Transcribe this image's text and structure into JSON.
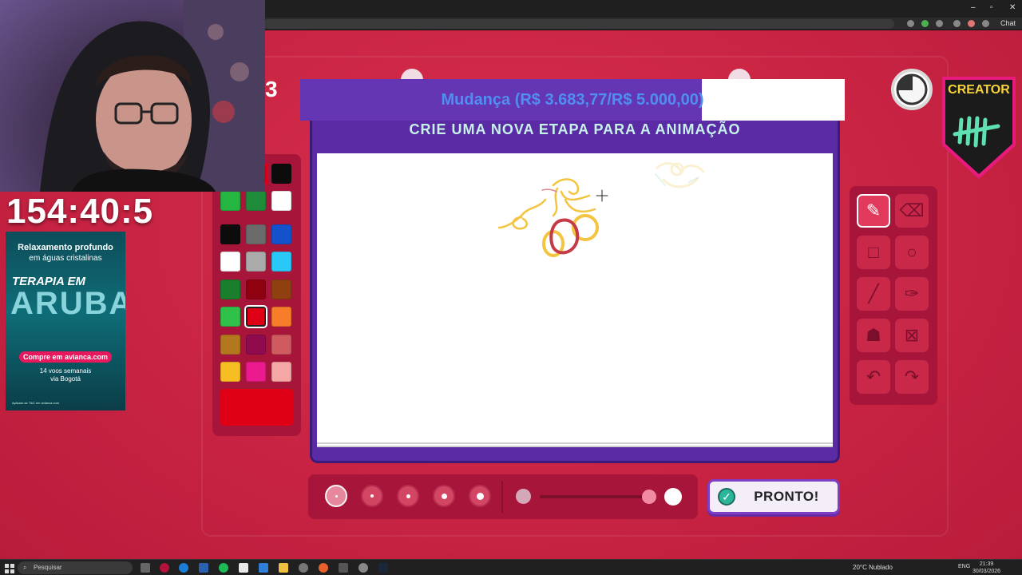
{
  "browser": {
    "chat_label": "Chat",
    "window_controls": {
      "minimize": "–",
      "maximize": "▫",
      "close": "✕"
    }
  },
  "game": {
    "donation_goal_text": "Mudança (R$ 3.683,77/R$ 5.000,00)",
    "donation_progress": 0.737,
    "instruction": "CRIE UMA NOVA ETAPA PARA A ANIMAÇÃO",
    "ready_button_label": "PRONTO!",
    "selected_color": "#e00016",
    "palette": [
      [
        "#25b642",
        "#1e8c3a",
        "#ffffff"
      ],
      [
        "#0c0c0c",
        "#6b6b6b",
        "#1452cc"
      ],
      [
        "#ffffff",
        "#aaaaaa",
        "#29c8f6"
      ],
      [
        "#1a7f2c",
        "#8f0011",
        "#8f3f10"
      ],
      [
        "#2fc14a",
        "#e00016",
        "#f77d2a"
      ],
      [
        "#b37720",
        "#8f0b4e",
        "#cf5a5f"
      ],
      [
        "#f7be24",
        "#ec1a8f",
        "#f6a7a5"
      ]
    ],
    "palette_top": [
      "#e00016",
      "#0c0c0c"
    ],
    "tools": [
      {
        "name": "pencil",
        "glyph": "✎",
        "active": true
      },
      {
        "name": "eraser",
        "glyph": "⌫",
        "active": false
      },
      {
        "name": "rectangle",
        "glyph": "□",
        "active": false
      },
      {
        "name": "ellipse",
        "glyph": "○",
        "active": false
      },
      {
        "name": "line",
        "glyph": "╱",
        "active": false
      },
      {
        "name": "eyedropper",
        "glyph": "✑",
        "active": false
      },
      {
        "name": "fill",
        "glyph": "☗",
        "active": false
      },
      {
        "name": "clear",
        "glyph": "⊠",
        "active": false
      },
      {
        "name": "undo",
        "glyph": "↶",
        "active": false
      },
      {
        "name": "redo",
        "glyph": "↷",
        "active": false
      }
    ],
    "brush_sizes": [
      {
        "size": "xs",
        "active": true
      },
      {
        "size": "s",
        "active": false
      },
      {
        "size": "m",
        "active": false
      },
      {
        "size": "l",
        "active": false
      },
      {
        "size": "xl",
        "active": false
      }
    ],
    "creator_badge": "CREATOR",
    "stream_cam_number": "3"
  },
  "overlays": {
    "stream_timer": "154:40:5",
    "ad": {
      "headline": "Relaxamento profundo",
      "subhead": "em águas cristalinas",
      "title_1": "TERAPIA EM",
      "title_2": "ARUBA",
      "cta": "Compre em avianca.com",
      "note_1": "14 voos semanais",
      "note_2": "via Bogotá",
      "fine_print": "Aplicam-se T&C em avianca.com"
    }
  },
  "taskbar": {
    "search_placeholder": "Pesquisar",
    "weather": "20°C Nublado",
    "language": "ENG",
    "time": "21:39",
    "date": "30/03/2026"
  }
}
